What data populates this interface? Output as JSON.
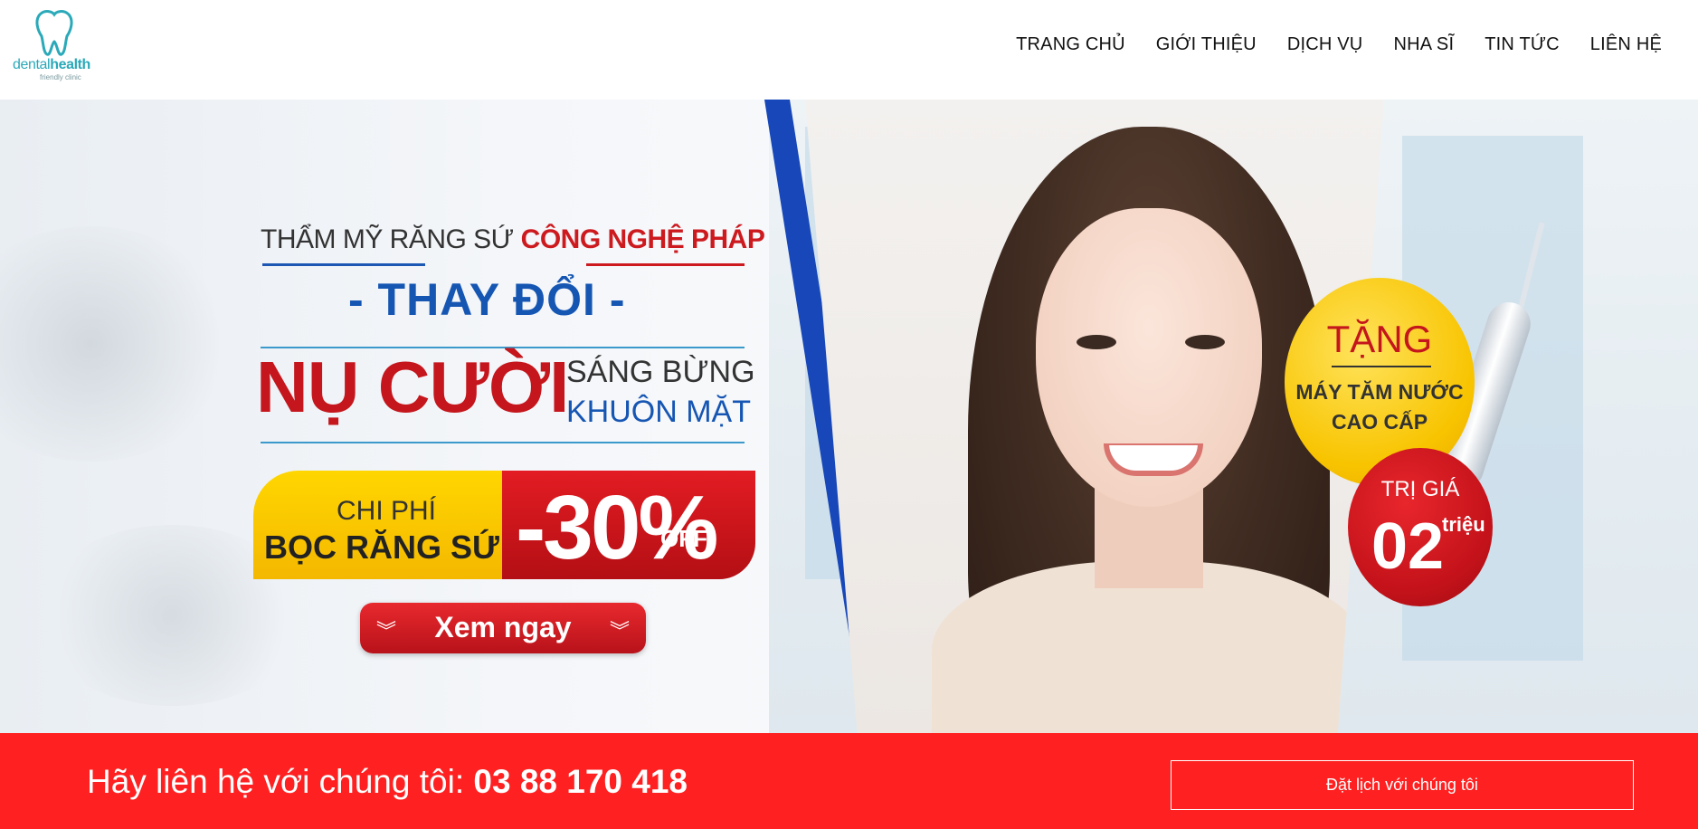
{
  "logo": {
    "word_a": "dental",
    "word_b": "health",
    "sub": "friendly clinic",
    "icon": "tooth-icon",
    "color": "#2aa9b9"
  },
  "nav": [
    "TRANG CHỦ",
    "GIỚI THIỆU",
    "DỊCH VỤ",
    "NHA SĨ",
    "TIN TỨC",
    "LIÊN HỆ"
  ],
  "banner": {
    "line1_prefix": "THẨM MỸ RĂNG SỨ",
    "line1_highlight": "CÔNG NGHỆ PHÁP",
    "line2": "- THAY ĐỔI -",
    "line3": "NỤ CƯỜI",
    "line4a": "SÁNG BỪNG",
    "line4b": "KHUÔN MẶT",
    "price_label1": "CHI PHÍ",
    "price_label2": "BỌC RĂNG SỨ",
    "discount": "-30%",
    "discount_suffix": "OFF",
    "cta": "Xem ngay",
    "cta_icon": "double-chevron-down-icon",
    "gift_title": "TẶNG",
    "gift_line1": "MÁY TĂM NƯỚC",
    "gift_line2": "CAO CẤP",
    "value_label": "TRỊ GIÁ",
    "value_amount": "02",
    "value_unit": "triệu"
  },
  "contact": {
    "prefix": "Hãy liên hệ với chúng tôi: ",
    "phone": "03 88 170 418",
    "button": "Đặt lịch với chúng tôi",
    "bar_color": "#ff2121"
  }
}
